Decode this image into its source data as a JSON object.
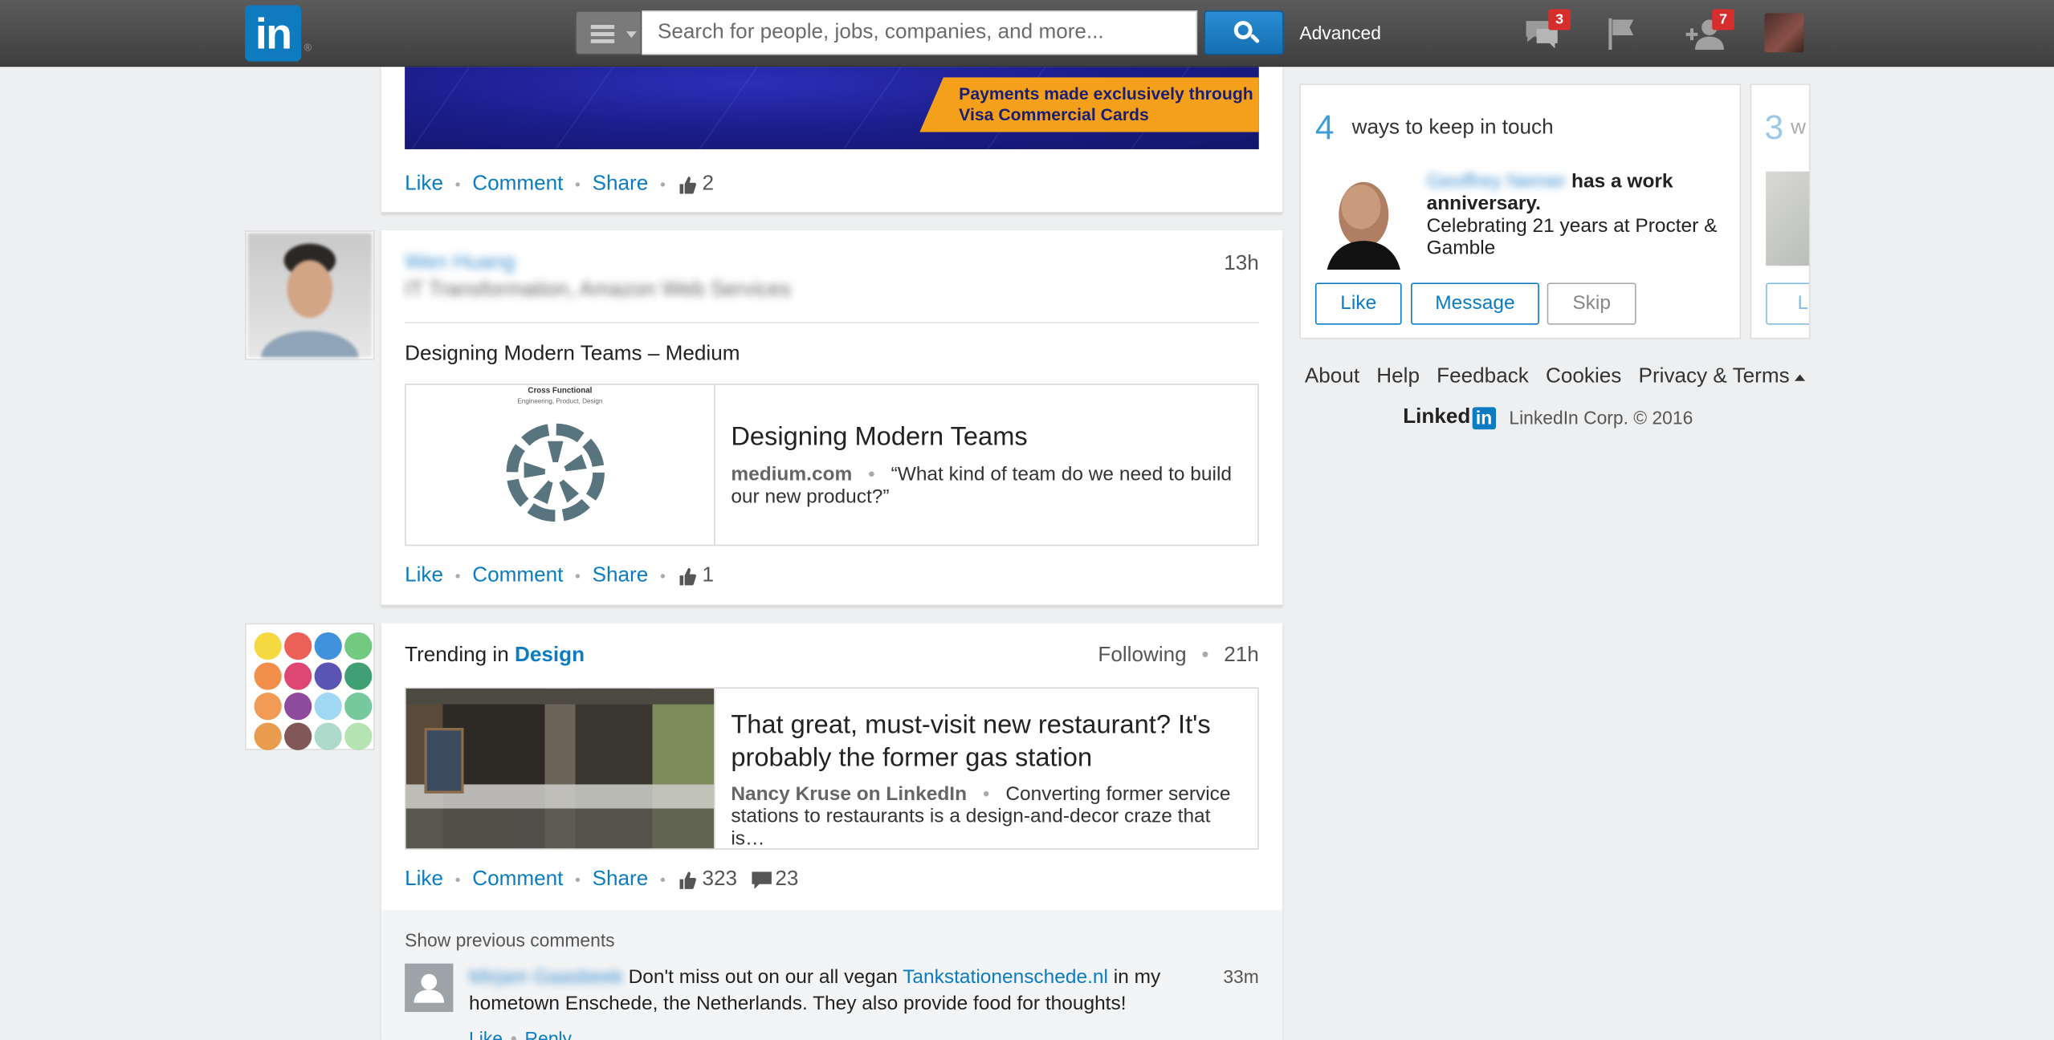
{
  "topbar": {
    "logo": "in",
    "search_placeholder": "Search for people, jobs, companies, and more...",
    "advanced_label": "Advanced",
    "messages_badge": "3",
    "connections_badge": "7"
  },
  "feed": {
    "post1": {
      "banner_text": "Payments made exclusively through Visa Commercial Cards",
      "actions": {
        "like": "Like",
        "comment": "Comment",
        "share": "Share",
        "likes_count": "2"
      }
    },
    "post2": {
      "author_name": "Wen Huang",
      "author_headline": "IT Transformation, Amazon Web Services",
      "time": "13h",
      "title": "Designing Modern Teams – Medium",
      "link_image_caption_1": "Cross Functional",
      "link_image_caption_2": "Engineering, Product, Design",
      "link_title": "Designing Modern Teams",
      "link_source": "medium.com",
      "link_excerpt": "“What kind of team do we need to build our new product?”",
      "actions": {
        "like": "Like",
        "comment": "Comment",
        "share": "Share",
        "likes_count": "1"
      }
    },
    "post3": {
      "trending_prefix": "Trending in ",
      "trending_topic": "Design",
      "following_label": "Following",
      "time": "21h",
      "link_title": "That great, must-visit new restaurant? It's probably the former gas station",
      "link_source": "Nancy Kruse on LinkedIn",
      "link_excerpt": "Converting former service stations to restaurants is a design-and-decor craze that is…",
      "actions": {
        "like": "Like",
        "comment": "Comment",
        "share": "Share",
        "likes_count": "323",
        "comments_count": "23"
      },
      "show_previous": "Show previous comments",
      "comment": {
        "author": "Mirjam Gaasbeek",
        "text_before": "Don't miss out on our all vegan ",
        "link": "Tankstationenschede.nl",
        "text_after": " in my hometown Enschede, the Netherlands. They also provide food for thoughts!",
        "time": "33m",
        "like": "Like",
        "reply": "Reply"
      }
    }
  },
  "rail": {
    "keep_in_touch": {
      "count": "4",
      "title": "ways to keep in touch",
      "person_name": "Geoffrey Nemer",
      "event": "has a work anniversary.",
      "detail": "Celebrating 21 years at Procter & Gamble",
      "like_btn": "Like",
      "message_btn": "Message",
      "skip_btn": "Skip"
    },
    "second_card": {
      "count": "3",
      "title_start": "w",
      "btn_start": "Li"
    },
    "footer": {
      "links": [
        "About",
        "Help",
        "Feedback",
        "Cookies",
        "Privacy & Terms"
      ],
      "brand_word": "Linked",
      "brand_in": "in",
      "copyright": "LinkedIn Corp. © 2016"
    }
  },
  "colors": {
    "brand_blue": "#0b7cc2",
    "badge_red": "#d62d2d",
    "topbar_gray": "#4a4a4a",
    "banner_orange": "#f4a01b"
  },
  "icons": [
    "menu-icon",
    "search-icon",
    "messages-icon",
    "flag-icon",
    "add-connection-icon",
    "thumb-up-icon",
    "comment-bubble-icon",
    "default-avatar-icon"
  ]
}
